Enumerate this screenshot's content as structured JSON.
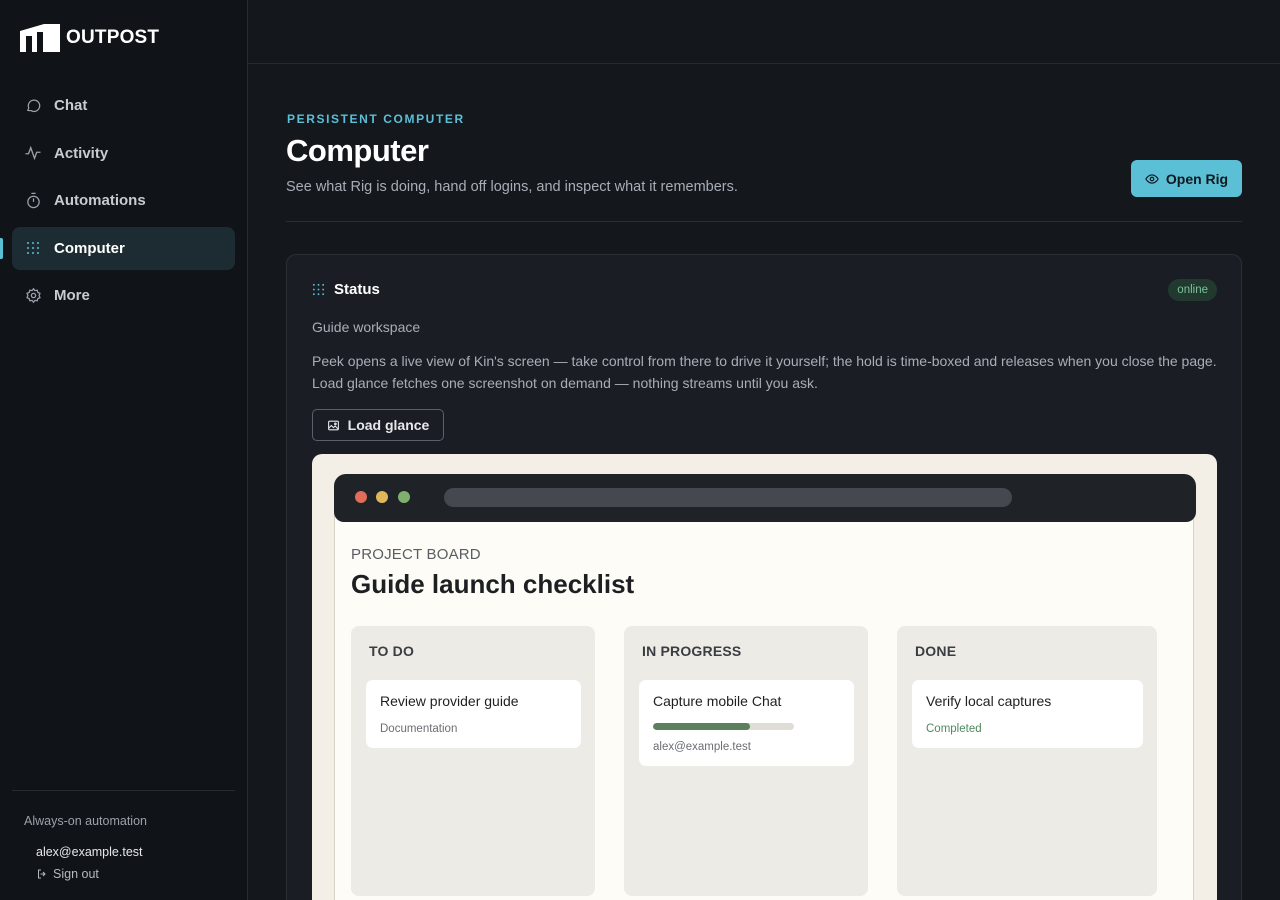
{
  "brand": {
    "name": "OUTPOST"
  },
  "nav": {
    "items": [
      {
        "label": "Chat",
        "icon": "chat-bubble-icon"
      },
      {
        "label": "Activity",
        "icon": "activity-pulse-icon"
      },
      {
        "label": "Automations",
        "icon": "timer-icon"
      },
      {
        "label": "Computer",
        "icon": "dot-grid-icon",
        "active": true
      },
      {
        "label": "More",
        "icon": "gear-icon"
      }
    ]
  },
  "sidebar_footer": {
    "title": "Always-on automation",
    "user_email": "alex@example.test",
    "signout_label": "Sign out"
  },
  "header": {
    "eyebrow": "PERSISTENT COMPUTER",
    "title": "Computer",
    "subtitle": "See what Rig is doing, hand off logins, and inspect what it remembers.",
    "open_button_label": "Open Rig"
  },
  "status_card": {
    "title": "Status",
    "badge": "online",
    "workspace": "Guide workspace",
    "description": "Peek opens a live view of Kin's screen — take control from there to drive it yourself; the hold is time-boxed and releases when you close the page. Load glance fetches one screenshot on demand — nothing streams until you ask.",
    "load_button_label": "Load glance"
  },
  "screenshot": {
    "eyebrow": "PROJECT BOARD",
    "title": "Guide launch checklist",
    "columns": [
      {
        "title": "TO DO",
        "task": {
          "title": "Review provider guide",
          "meta": "Documentation"
        }
      },
      {
        "title": "IN PROGRESS",
        "task": {
          "title": "Capture mobile Chat",
          "progress": 0.69,
          "meta": "alex@example.test"
        }
      },
      {
        "title": "DONE",
        "task": {
          "title": "Verify local captures",
          "meta": "Completed"
        }
      }
    ]
  },
  "colors": {
    "accent": "#5bbfd6",
    "online": "#7dc09b",
    "progress": "#5c7f5e",
    "traffic_red": "#e06c5a",
    "traffic_yellow": "#e0b65a",
    "traffic_green": "#7fb06e"
  }
}
